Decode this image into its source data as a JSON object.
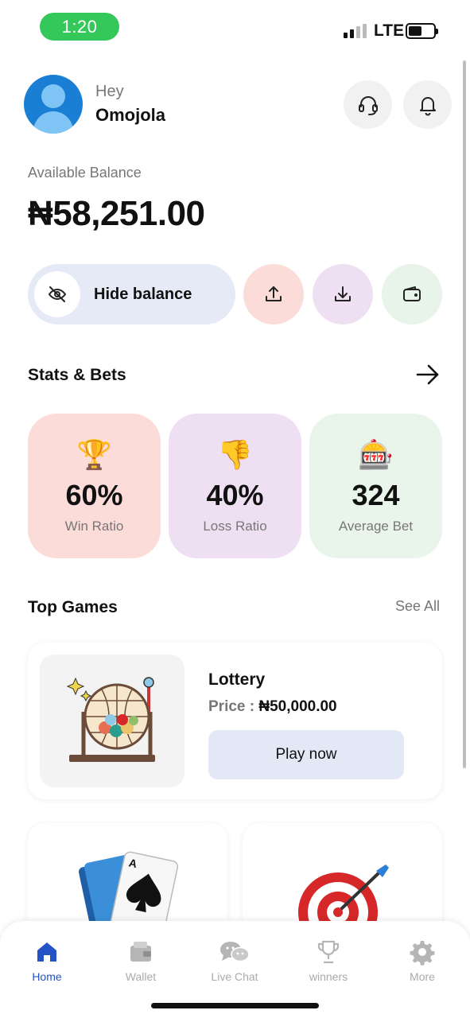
{
  "status_bar": {
    "time": "1:20",
    "network": "LTE"
  },
  "header": {
    "greeting": "Hey",
    "username": "Omojola"
  },
  "balance": {
    "label": "Available Balance",
    "amount": "₦58,251.00"
  },
  "actions": {
    "hide_balance_label": "Hide balance"
  },
  "stats": {
    "title": "Stats & Bets",
    "cards": [
      {
        "emoji": "🏆",
        "value": "60%",
        "label": "Win Ratio"
      },
      {
        "emoji": "👎",
        "value": "40%",
        "label": "Loss Ratio"
      },
      {
        "emoji": "🎰",
        "value": "324",
        "label": "Average Bet"
      }
    ]
  },
  "top_games": {
    "title": "Top Games",
    "see_all": "See All",
    "featured": {
      "name": "Lottery",
      "price_label": "Price : ",
      "price": "₦50,000.00",
      "play_label": "Play now"
    }
  },
  "bottom_nav": {
    "items": [
      {
        "label": "Home",
        "icon": "home-icon",
        "active": true
      },
      {
        "label": "Wallet",
        "icon": "wallet-icon",
        "active": false
      },
      {
        "label": "Live Chat",
        "icon": "chat-icon",
        "active": false
      },
      {
        "label": "winners",
        "icon": "trophy-icon",
        "active": false
      },
      {
        "label": "More",
        "icon": "gear-icon",
        "active": false
      }
    ]
  },
  "colors": {
    "primary": "#2453c6",
    "win_card": "#fcdcd9",
    "loss_card": "#efdff2",
    "avg_card": "#e9f5ea",
    "time_pill": "#34c759"
  }
}
